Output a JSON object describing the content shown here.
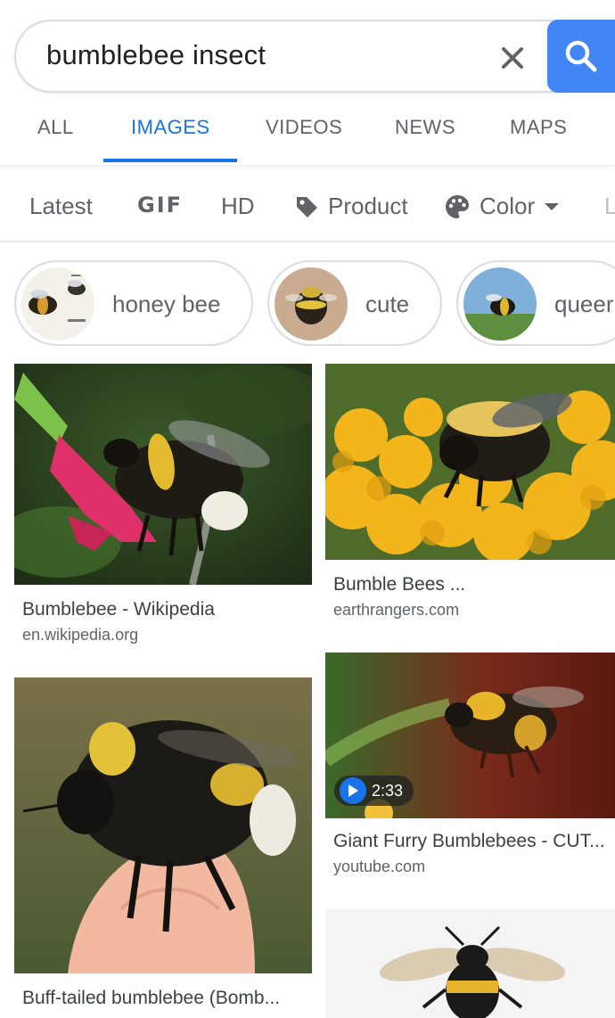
{
  "search": {
    "query": "bumblebee insect",
    "clear_icon": "close-icon",
    "search_icon": "search-icon",
    "accent": "#4285f4"
  },
  "tabs": [
    {
      "label": "ALL",
      "active": false
    },
    {
      "label": "IMAGES",
      "active": true
    },
    {
      "label": "VIDEOS",
      "active": false
    },
    {
      "label": "NEWS",
      "active": false
    },
    {
      "label": "MAPS",
      "active": false
    }
  ],
  "filters": [
    {
      "label": "Latest"
    },
    {
      "label": "GIF"
    },
    {
      "label": "HD"
    },
    {
      "label": "Product",
      "icon": "tag-icon"
    },
    {
      "label": "Color",
      "icon": "palette-icon",
      "dropdown": "caret-down-icon"
    },
    {
      "label": "L"
    }
  ],
  "chips": [
    {
      "label": "honey bee"
    },
    {
      "label": "cute"
    },
    {
      "label": "queer"
    }
  ],
  "results": [
    {
      "title": "Bumblebee - Wikipedia",
      "domain": "en.wikipedia.org"
    },
    {
      "title": "Bumble Bees ...",
      "domain": "earthrangers.com"
    },
    {
      "title": "Giant Furry Bumblebees - CUT...",
      "domain": "youtube.com",
      "duration": "2:33"
    },
    {
      "title": "Buff-tailed bumblebee (Bomb...",
      "domain": ""
    }
  ]
}
